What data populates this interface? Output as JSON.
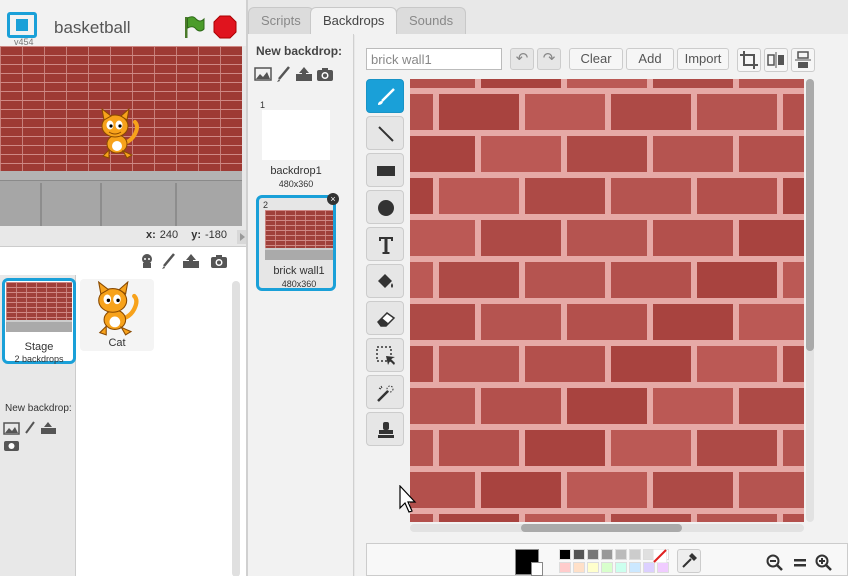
{
  "stage_header": {
    "version": "v454",
    "project_title": "basketball",
    "icons": [
      "fullscreen-icon",
      "green-flag-icon",
      "stop-icon"
    ]
  },
  "stage_coords": {
    "x_label": "x:",
    "x_value": "240",
    "y_label": "y:",
    "y_value": "-180"
  },
  "sprite_pane": {
    "toolbar_icons": [
      "choose-sprite-icon",
      "paint-sprite-icon",
      "upload-sprite-icon",
      "camera-sprite-icon"
    ],
    "stage": {
      "name": "Stage",
      "sub": "2 backdrops"
    },
    "new_backdrop_label": "New backdrop:",
    "sprites": [
      {
        "name": "Cat"
      }
    ]
  },
  "tabs": [
    {
      "label": "Scripts"
    },
    {
      "label": "Backdrops"
    },
    {
      "label": "Sounds"
    }
  ],
  "active_tab": "Backdrops",
  "backdrops_panel": {
    "new_label": "New backdrop:",
    "items": [
      {
        "num": "1",
        "name": "backdrop1",
        "size": "480x360"
      },
      {
        "num": "2",
        "name": "brick wall1",
        "size": "480x360"
      }
    ]
  },
  "editor": {
    "costume_name": "brick wall1",
    "buttons": {
      "clear": "Clear",
      "add": "Add",
      "import": "Import"
    },
    "tools": [
      "brush-tool",
      "line-tool",
      "rectangle-tool",
      "ellipse-tool",
      "text-tool",
      "fill-tool",
      "eraser-tool",
      "select-tool",
      "magic-select-tool",
      "stamp-tool"
    ],
    "colors": {
      "primary": "#000000",
      "accent": "#1aa0d8",
      "brick": "#b54f4b",
      "swatches_top": [
        "#000000",
        "#555555",
        "#777777",
        "#999999",
        "#bbbbbb",
        "#cccccc",
        "#e0e0e0",
        "#ffffff"
      ],
      "swatches_bottom": [
        "#ffcccc",
        "#ffe0c8",
        "#ffffcc",
        "#d8ffcc",
        "#ccffee",
        "#cce8ff",
        "#dcd0ff",
        "#f0ccff"
      ]
    }
  }
}
